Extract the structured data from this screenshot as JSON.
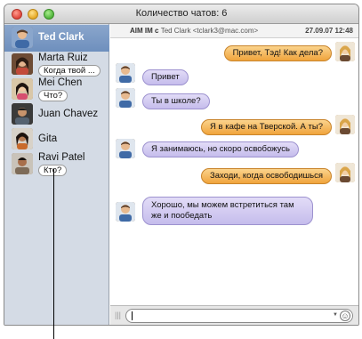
{
  "window": {
    "title": "Количество чатов: 6"
  },
  "sidebar": {
    "items": [
      {
        "name": "Ted Clark",
        "status": "",
        "selected": true
      },
      {
        "name": "Marta Ruiz",
        "status": "Когда твой ..."
      },
      {
        "name": "Mei Chen",
        "status": "Что?"
      },
      {
        "name": "Juan Chavez",
        "status": ""
      },
      {
        "name": "Gita",
        "status": ""
      },
      {
        "name": "Ravi Patel",
        "status": "Кто?"
      }
    ]
  },
  "chat_header": {
    "service": "AIM IM с",
    "contact": "Ted Clark <tclark3@mac.com>",
    "date": "27.09.07 12:48"
  },
  "messages": [
    {
      "from": "me",
      "text": "Привет, Тэд! Как дела?"
    },
    {
      "from": "ted",
      "text": "Привет"
    },
    {
      "from": "ted",
      "text": "Ты в школе?"
    },
    {
      "from": "me",
      "text": "Я в кафе на Тверской. А ты?"
    },
    {
      "from": "ted",
      "text": "Я занимаюсь, но скоро освобожусь"
    },
    {
      "from": "me",
      "text": "Заходи, когда освободишься"
    },
    {
      "from": "ted",
      "text": "Хорошо, мы можем встретиться там же и пообедать"
    }
  ],
  "colors": {
    "incoming_bubble": "#c5bcec",
    "outgoing_bubble": "#f0a43c",
    "selection": "#6e8fbd",
    "sidebar": "#d4dbe5"
  },
  "input": {
    "placeholder": "",
    "emoji_icon": "smiley-icon"
  }
}
